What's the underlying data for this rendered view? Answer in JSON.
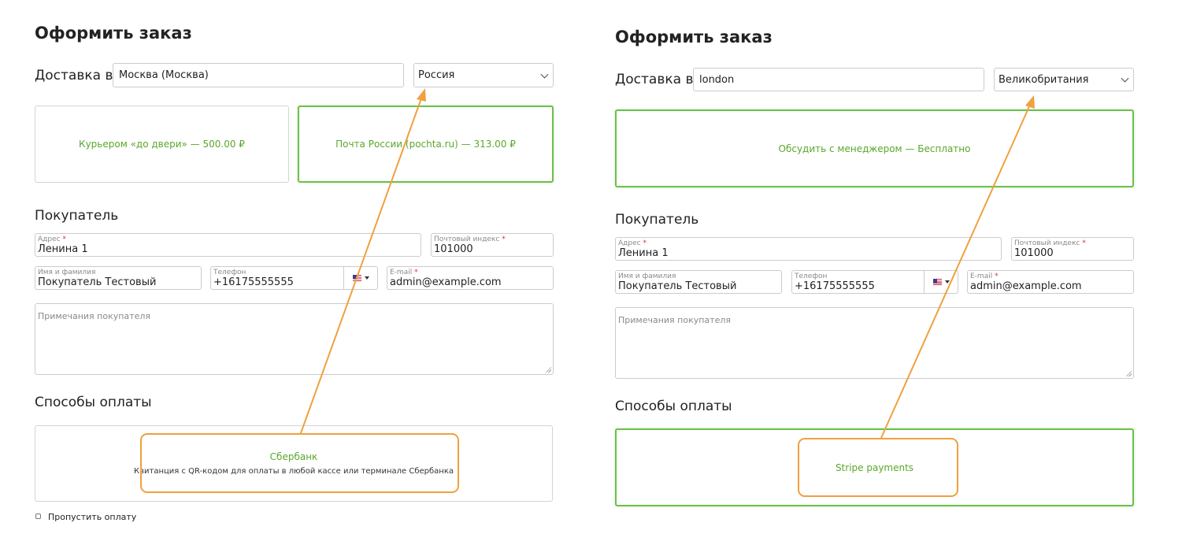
{
  "left": {
    "title": "Оформить заказ",
    "delivery_label": "Доставка в",
    "city_value": "Москва (Москва)",
    "country_selected": "Россия",
    "shipping_options": [
      {
        "label": "Курьером «до двери» — 500.00 ₽",
        "selected": false
      },
      {
        "label": "Почта России (pochta.ru) — 313.00 ₽",
        "selected": true
      }
    ],
    "buyer_heading": "Покупатель",
    "address_label": "Адрес",
    "address_value": "Ленина 1",
    "zip_label": "Почтовый индекс",
    "zip_value": "101000",
    "name_label": "Имя и фамилия",
    "name_value": "Покупатель Тестовый",
    "phone_label": "Телефон",
    "phone_value": "+16175555555",
    "email_label": "E-mail",
    "email_value": "admin@example.com",
    "notes_placeholder": "Примечания покупателя",
    "payment_heading": "Способы оплаты",
    "payment_name": "Сбербанк",
    "payment_desc": "Квитанция с QR-кодом для оплаты в любой кассе или терминале Сбербанка",
    "skip_payment_label": "Пропустить оплату"
  },
  "right": {
    "title": "Оформить заказ",
    "delivery_label": "Доставка в",
    "city_value": "london",
    "country_selected": "Великобритания",
    "shipping_options": [
      {
        "label": "Обсудить с менеджером — Бесплатно",
        "selected": true
      }
    ],
    "buyer_heading": "Покупатель",
    "address_label": "Адрес",
    "address_value": "Ленина 1",
    "zip_label": "Почтовый индекс",
    "zip_value": "101000",
    "name_label": "Имя и фамилия",
    "name_value": "Покупатель Тестовый",
    "phone_label": "Телефон",
    "phone_value": "+16175555555",
    "email_label": "E-mail",
    "email_value": "admin@example.com",
    "notes_placeholder": "Примечания покупателя",
    "payment_heading": "Способы оплаты",
    "payment_name": "Stripe payments"
  },
  "colors": {
    "accent_green": "#59a82a",
    "selected_border": "#6cc04a",
    "annotation_orange": "#f0a040",
    "required_red": "#d0312d"
  },
  "icons": [
    "chevron-down-icon",
    "us-flag-icon",
    "caret-down-icon",
    "resize-grip-icon",
    "annotation-arrow"
  ]
}
